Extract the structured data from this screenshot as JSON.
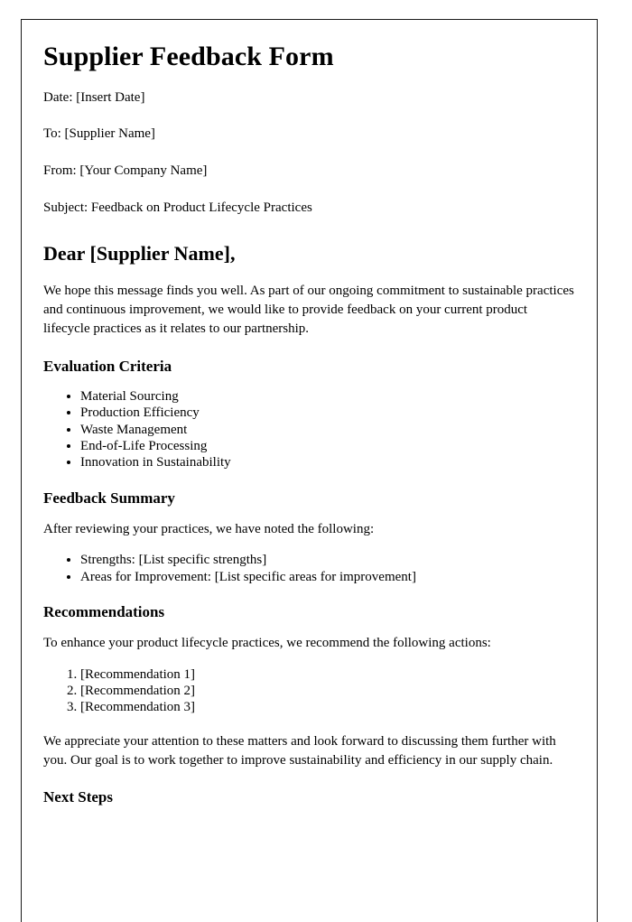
{
  "document": {
    "title": "Supplier Feedback Form",
    "meta": [
      {
        "label": "Date",
        "text": "Date: [Insert Date]"
      },
      {
        "label": "To",
        "text": "To: [Supplier Name]"
      },
      {
        "label": "From",
        "text": "From: [Your Company Name]"
      },
      {
        "label": "Subject",
        "text": "Subject: Feedback on Product Lifecycle Practices"
      }
    ],
    "salutation": "Dear [Supplier Name],",
    "intro_paragraph": "We hope this message finds you well. As part of our ongoing commitment to sustainable practices and continuous improvement, we would like to provide feedback on your current product lifecycle practices as it relates to our partnership.",
    "sections": {
      "evaluation_criteria": {
        "heading": "Evaluation Criteria",
        "items": [
          "Material Sourcing",
          "Production Efficiency",
          "Waste Management",
          "End-of-Life Processing",
          "Innovation in Sustainability"
        ]
      },
      "feedback_summary": {
        "heading": "Feedback Summary",
        "lead_in": "After reviewing your practices, we have noted the following:",
        "items": [
          "Strengths: [List specific strengths]",
          "Areas for Improvement: [List specific areas for improvement]"
        ]
      },
      "recommendations": {
        "heading": "Recommendations",
        "lead_in": "To enhance your product lifecycle practices, we recommend the following actions:",
        "items": [
          "[Recommendation 1]",
          "[Recommendation 2]",
          "[Recommendation 3]"
        ]
      },
      "closing_paragraph": "We appreciate your attention to these matters and look forward to discussing them further with you. Our goal is to work together to improve sustainability and efficiency in our supply chain.",
      "next_steps": {
        "heading": "Next Steps"
      }
    }
  }
}
